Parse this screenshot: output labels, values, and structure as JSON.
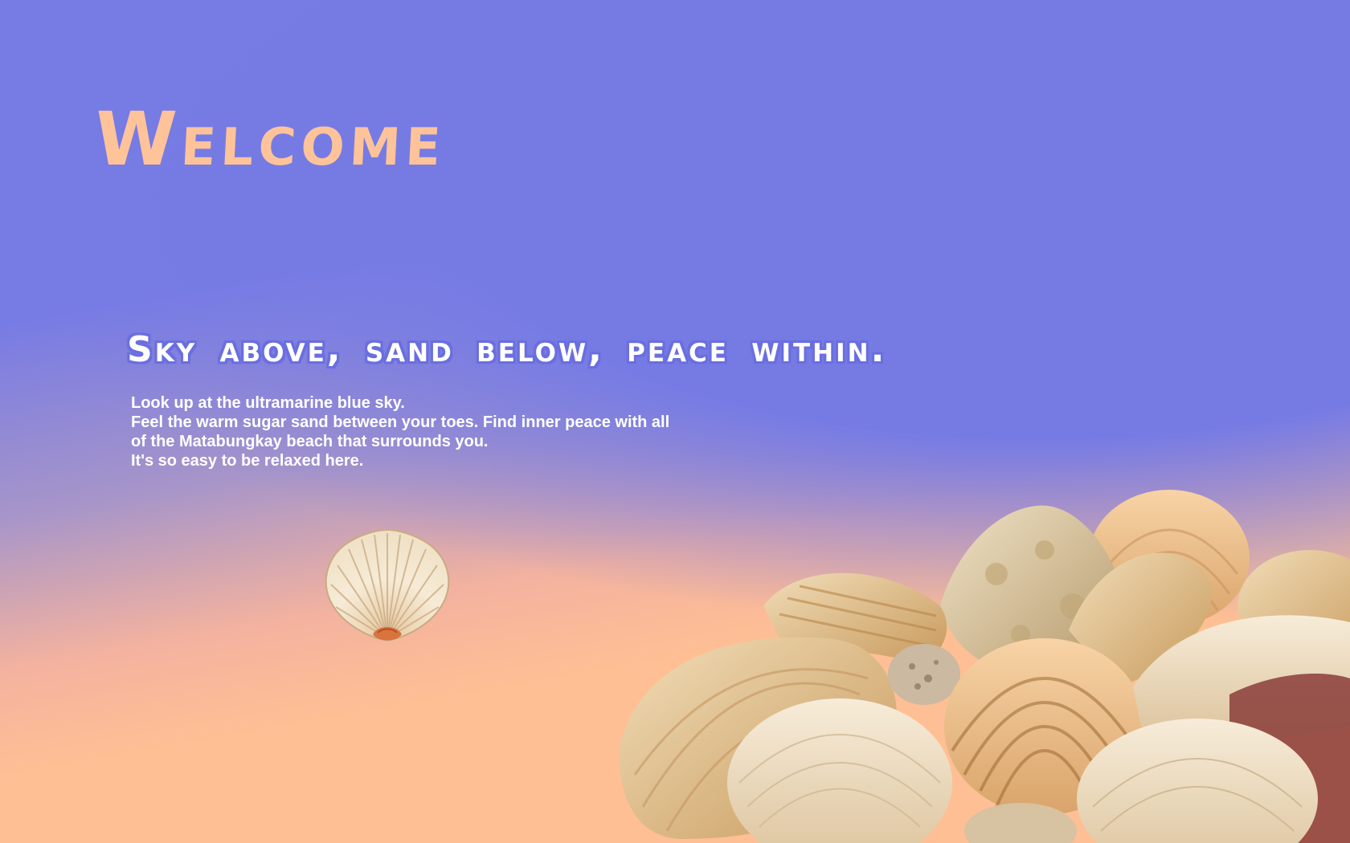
{
  "hero": {
    "title": "Welcome"
  },
  "content": {
    "tagline": "Sky above, sand below, peace within.",
    "description_lines": [
      "Look up at the ultramarine blue sky.",
      "Feel the warm sugar sand between your toes. Find inner peace with all",
      "of the Matabungkay beach that surrounds you.",
      "It's so easy to be relaxed here."
    ]
  },
  "images": {
    "single_shell": "scallop-shell-icon",
    "shell_pile": "seashell-pile-image"
  },
  "colors": {
    "sky": "#777be4",
    "sand": "#ffbf94",
    "title": "#ffc39a",
    "tagline_outline": "#6a6fe0",
    "text": "#ffffff"
  }
}
